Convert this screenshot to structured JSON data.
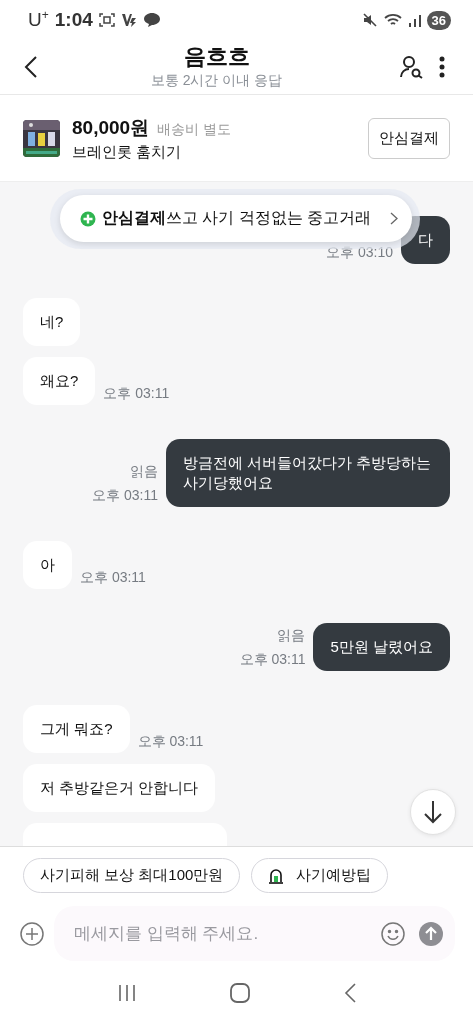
{
  "status_bar": {
    "carrier": "U$^{+}$",
    "time": "1:04",
    "battery": "36"
  },
  "header": {
    "title": "음흐흐",
    "subtitle": "보통 2시간 이내 응답"
  },
  "product": {
    "price": "80,000원",
    "shipping": "배송비 별도",
    "name": "브레인롯 훔치기",
    "button": "안심결제"
  },
  "banner": {
    "text": "**안심결제**쓰고 사기 걱정없는 중고거래"
  },
  "messages": [
    {
      "kind": "sent",
      "text": "다",
      "time": "오후 03:10"
    },
    {
      "kind": "received",
      "text": "네?"
    },
    {
      "kind": "received",
      "text": "왜요?",
      "time": "오후 03:11"
    },
    {
      "kind": "sent",
      "text": "방금전에 서버들어갔다가 추방당하는 사기당했어요",
      "read": "읽음",
      "time": "오후 03:11"
    },
    {
      "kind": "received",
      "text": "아",
      "time": "오후 03:11"
    },
    {
      "kind": "sent",
      "text": "5만원 날렸어요",
      "read": "읽음",
      "time": "오후 03:11"
    },
    {
      "kind": "received",
      "text": "그게 뭐죠?",
      "time": "오후 03:11"
    },
    {
      "kind": "received",
      "text": "저 추방같은거 안합니다"
    },
    {
      "kind": "received"
    }
  ],
  "chips": [
    {
      "kind": "text",
      "label": "사기피해 보상 최대100만원"
    },
    {
      "kind": "icon",
      "label": "사기예방팁"
    }
  ],
  "input": {
    "placeholder": "메세지를 입력해 주세요."
  }
}
